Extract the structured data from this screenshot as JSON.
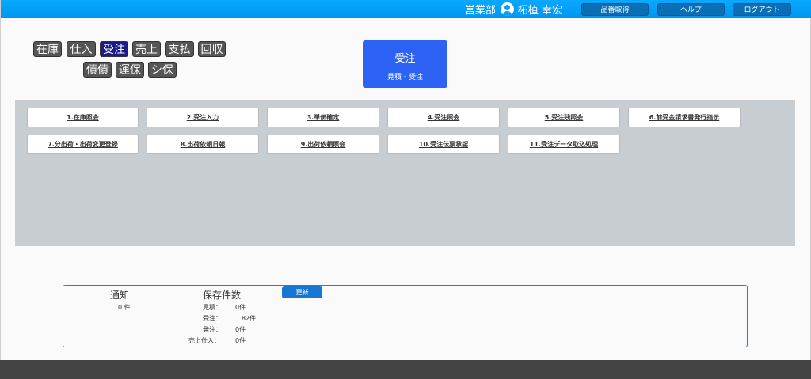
{
  "header": {
    "department": "営業部",
    "user_name": "柘植 幸宏",
    "buttons": [
      "品番取得",
      "ヘルプ",
      "ログアウト"
    ]
  },
  "categories": {
    "row1": [
      "在庫",
      "仕入",
      "受注",
      "売上",
      "支払",
      "回収"
    ],
    "row2": [
      "債債",
      "運保",
      "シ保"
    ],
    "active": "受注"
  },
  "selected": {
    "title": "受注",
    "subtitle": "見積・受注"
  },
  "menu": {
    "row1": [
      "1.在庫照会",
      "2.受注入力",
      "3.単価確定",
      "4.受注照会",
      "5.受注残照会",
      "6.前受金請求書発行指示"
    ],
    "row2": [
      "7.分出荷・出荷変更登録",
      "8.出荷依頼日報",
      "9.出荷依頼照会",
      "10.受注伝票承認",
      "11.受注データ取込処理"
    ]
  },
  "info": {
    "notice_title": "通知",
    "notice_count": "0 件",
    "saved_title": "保存件数",
    "refresh_label": "更新",
    "saved_items": [
      {
        "label": "見積：",
        "value": "0件"
      },
      {
        "label": "受注：",
        "value": "82件"
      },
      {
        "label": "発注：",
        "value": "0件"
      },
      {
        "label": "売上仕入：",
        "value": "0件"
      }
    ]
  },
  "colors": {
    "topbar": "#0aa0f8",
    "active_tab": "#1a1a8e",
    "selected_box": "#2d63f5",
    "panel": "#c8cdd2",
    "info_border": "#2b7ad6"
  }
}
